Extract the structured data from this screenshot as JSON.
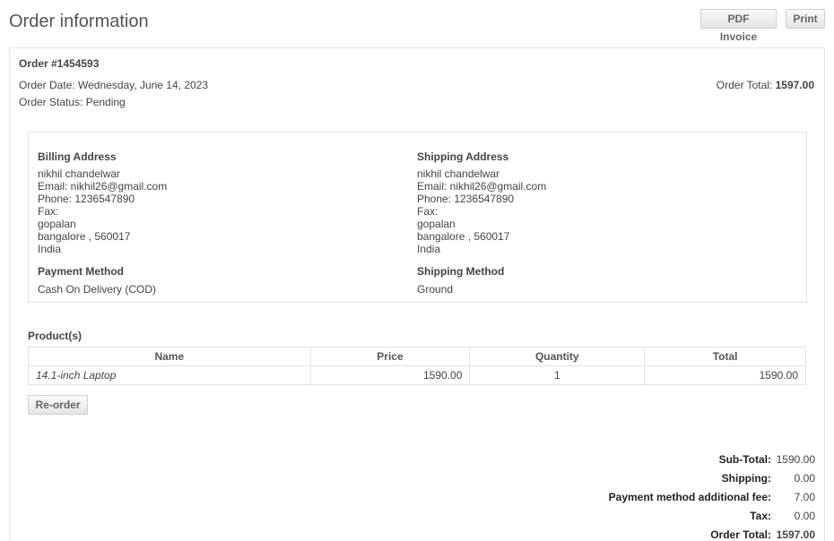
{
  "header": {
    "title": "Order information",
    "pdf_invoice_label": "PDF Invoice",
    "print_label": "Print"
  },
  "order": {
    "number": "Order #1454593",
    "date": "Order Date: Wednesday, June 14, 2023",
    "status": "Order Status: Pending",
    "total_label": "Order Total:",
    "total_value": "1597.00"
  },
  "billing": {
    "title": "Billing Address",
    "lines": [
      "nikhil chandelwar",
      "Email: nikhil26@gmail.com",
      "Phone: 1236547890",
      "Fax:",
      "gopalan",
      "bangalore , 560017",
      "India"
    ]
  },
  "shipping": {
    "title": "Shipping Address",
    "lines": [
      "nikhil chandelwar",
      "Email: nikhil26@gmail.com",
      "Phone: 1236547890",
      "Fax:",
      "gopalan",
      "bangalore , 560017",
      "India"
    ]
  },
  "payment": {
    "title": "Payment Method",
    "value": "Cash On Delivery (COD)"
  },
  "shipping_method": {
    "title": "Shipping Method",
    "value": "Ground"
  },
  "products": {
    "title": "Product(s)",
    "columns": [
      "Name",
      "Price",
      "Quantity",
      "Total"
    ],
    "rows": [
      {
        "name": "14.1-inch Laptop",
        "price": "1590.00",
        "quantity": "1",
        "total": "1590.00"
      }
    ]
  },
  "reorder_label": "Re-order",
  "totals": [
    {
      "label": "Sub-Total:",
      "value": "1590.00"
    },
    {
      "label": "Shipping:",
      "value": "0.00"
    },
    {
      "label": "Payment method additional fee:",
      "value": "7.00"
    },
    {
      "label": "Tax:",
      "value": "0.00"
    },
    {
      "label": "Order Total:",
      "value": "1597.00"
    }
  ]
}
